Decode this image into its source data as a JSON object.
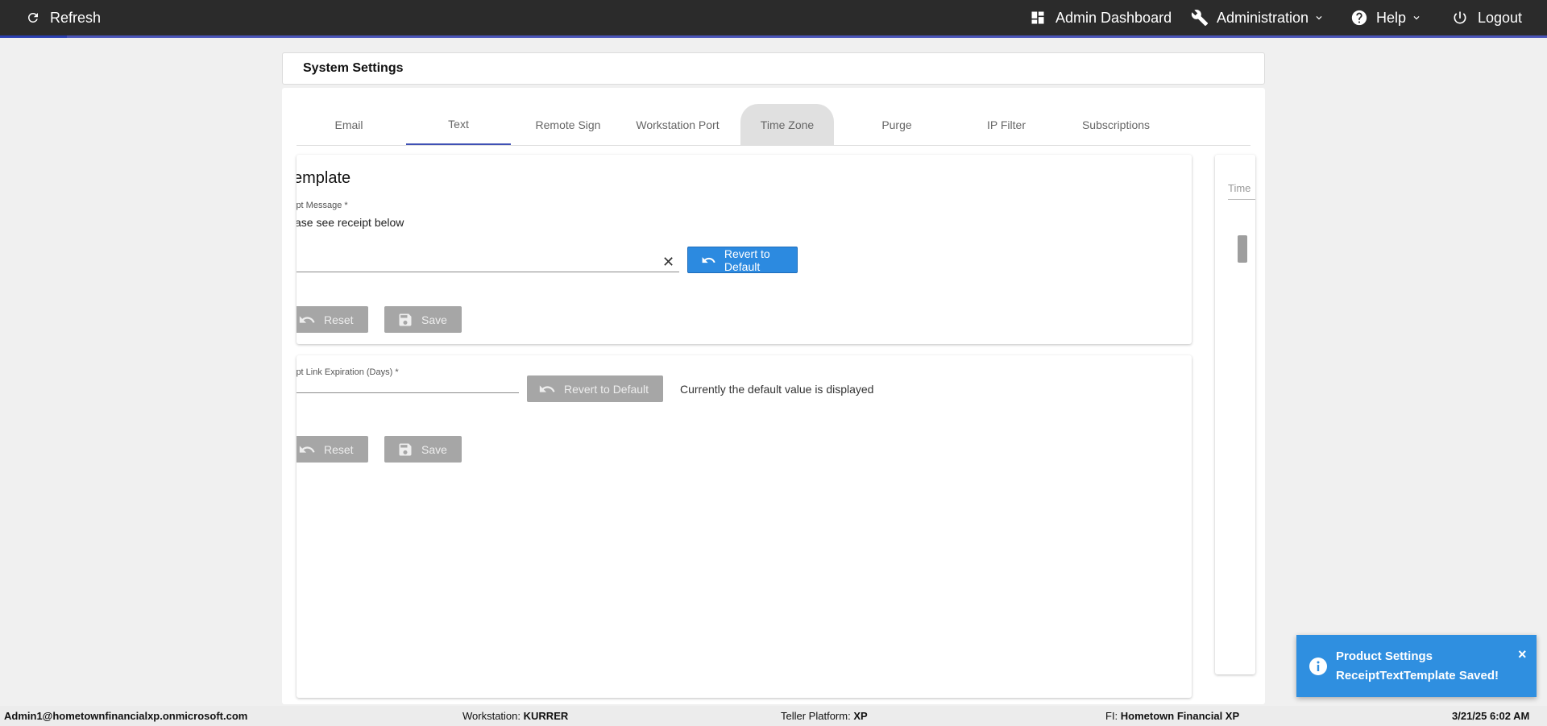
{
  "topbar": {
    "refresh_label": "Refresh",
    "admin_dashboard_label": "Admin Dashboard",
    "administration_label": "Administration",
    "help_label": "Help",
    "logout_label": "Logout"
  },
  "page": {
    "title": "System Settings"
  },
  "tabs": [
    {
      "label": "Email"
    },
    {
      "label": "Text"
    },
    {
      "label": "Remote Sign"
    },
    {
      "label": "Workstation Port"
    },
    {
      "label": "Time Zone"
    },
    {
      "label": "Purge"
    },
    {
      "label": "IP Filter"
    },
    {
      "label": "Subscriptions"
    }
  ],
  "active_tab": "Text",
  "receipt_template": {
    "heading": "Template",
    "field_label": "ipt Message *",
    "field_value": "ase see receipt below",
    "clear_icon": "close-icon",
    "revert_label": "Revert to Default",
    "reset_label": "Reset",
    "save_label": "Save"
  },
  "receipt_link": {
    "field_label": "ipt Link Expiration (Days) *",
    "field_value": "",
    "revert_label": "Revert to Default",
    "note": "Currently the default value is displayed",
    "reset_label": "Reset",
    "save_label": "Save"
  },
  "timezone_card": {
    "label": "Time"
  },
  "toast": {
    "title": "Product Settings",
    "message": "ReceiptTextTemplate Saved!",
    "close": "×",
    "color": "#2f8fe0"
  },
  "footer": {
    "user": "Admin1@hometownfinancialxp.onmicrosoft.com",
    "workstation_label": "Workstation:",
    "workstation_value": "KURRER",
    "teller_label": "Teller Platform:",
    "teller_value": "XP",
    "fi_label": "FI:",
    "fi_value": "Hometown Financial XP",
    "datetime": "3/21/25 6:02 AM"
  },
  "colors": {
    "topbar": "#2b2b2b",
    "primary_button": "#2c8ae0",
    "disabled_button": "#a6a6a6",
    "tab_indicator": "#3f51b5"
  }
}
